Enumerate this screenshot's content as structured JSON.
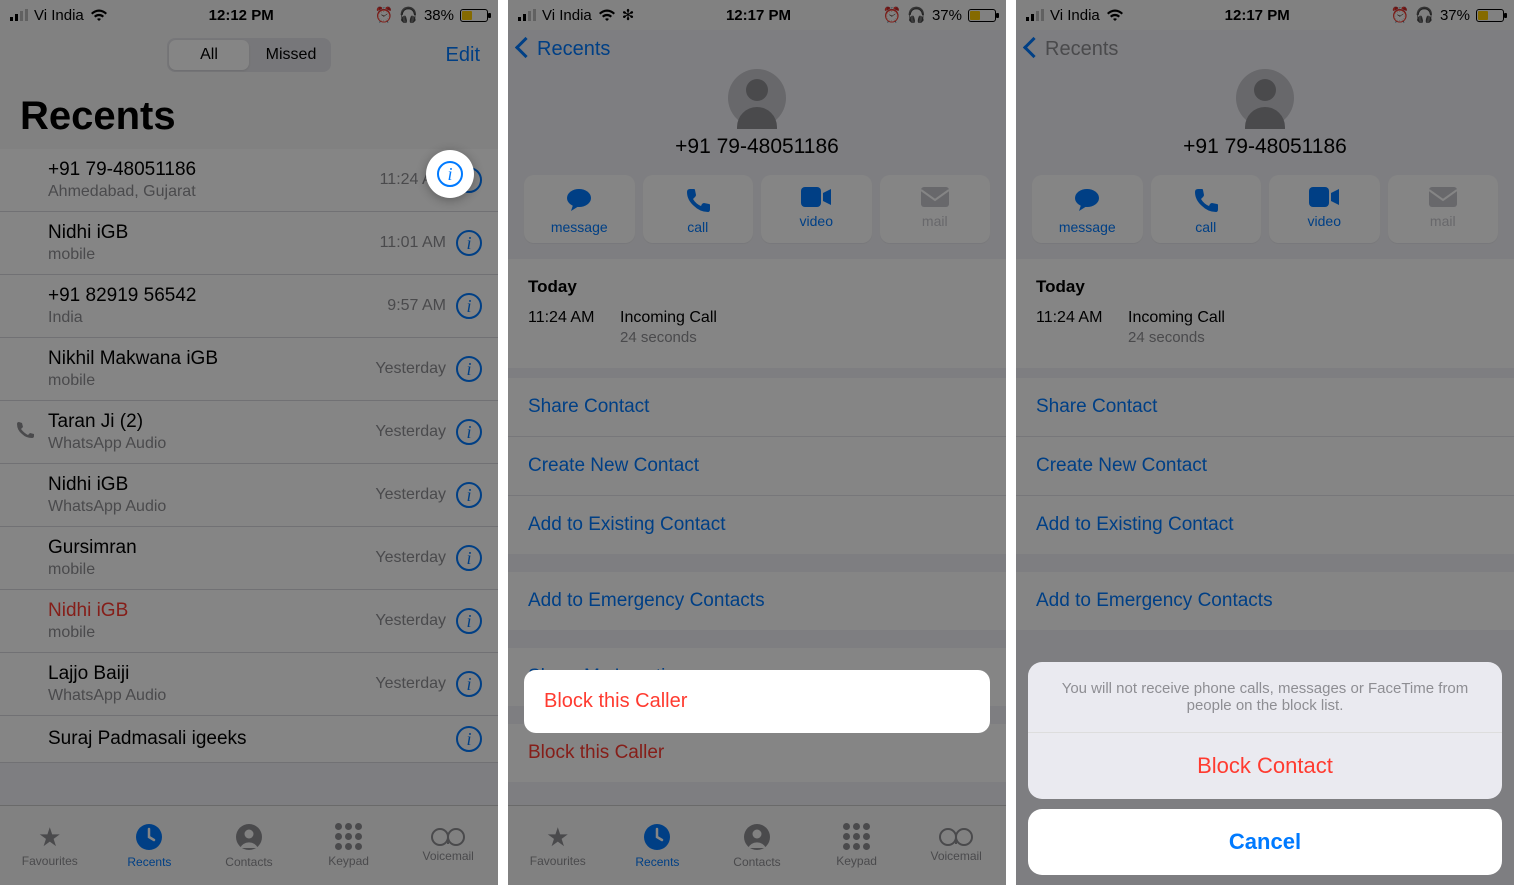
{
  "screens": {
    "s1": {
      "status": {
        "carrier": "Vi India",
        "time": "12:12 PM",
        "battery": "38%"
      },
      "nav": {
        "seg_all": "All",
        "seg_missed": "Missed",
        "edit": "Edit"
      },
      "title": "Recents",
      "calls": [
        {
          "name": "+91 79-48051186",
          "sub": "Ahmedabad, Gujarat",
          "time": "11:24 AM",
          "missed": false,
          "incoming": false,
          "highlight": true
        },
        {
          "name": "Nidhi iGB",
          "sub": "mobile",
          "time": "11:01 AM",
          "missed": false,
          "incoming": false
        },
        {
          "name": "+91 82919 56542",
          "sub": "India",
          "time": "9:57 AM",
          "missed": false,
          "incoming": false
        },
        {
          "name": "Nikhil Makwana iGB",
          "sub": "mobile",
          "time": "Yesterday",
          "missed": false,
          "incoming": false
        },
        {
          "name": "Taran Ji (2)",
          "sub": "WhatsApp Audio",
          "time": "Yesterday",
          "missed": false,
          "incoming": true
        },
        {
          "name": "Nidhi iGB",
          "sub": "WhatsApp Audio",
          "time": "Yesterday",
          "missed": false,
          "incoming": false
        },
        {
          "name": "Gursimran",
          "sub": "mobile",
          "time": "Yesterday",
          "missed": false,
          "incoming": false
        },
        {
          "name": "Nidhi iGB",
          "sub": "mobile",
          "time": "Yesterday",
          "missed": true,
          "incoming": false
        },
        {
          "name": "Lajjo Baiji",
          "sub": "WhatsApp Audio",
          "time": "Yesterday",
          "missed": false,
          "incoming": false
        },
        {
          "name": "Suraj Padmasali igeeks",
          "sub": "",
          "time": "",
          "missed": false,
          "incoming": false
        }
      ]
    },
    "s2": {
      "status": {
        "carrier": "Vi India",
        "time": "12:17 PM",
        "battery": "37%"
      },
      "back": "Recents",
      "number": "+91 79-48051186",
      "actions": {
        "message": "message",
        "call": "call",
        "video": "video",
        "mail": "mail"
      },
      "today": "Today",
      "log": {
        "time": "11:24 AM",
        "type": "Incoming Call",
        "duration": "24 seconds"
      },
      "rows": {
        "share_contact": "Share Contact",
        "create_new": "Create New Contact",
        "add_existing": "Add to Existing Contact",
        "emergency": "Add to Emergency Contacts",
        "share_loc": "Share My Location",
        "block": "Block this Caller"
      }
    },
    "s3": {
      "status": {
        "carrier": "Vi India",
        "time": "12:17 PM",
        "battery": "37%"
      },
      "back": "Recents",
      "number": "+91 79-48051186",
      "actions": {
        "message": "message",
        "call": "call",
        "video": "video",
        "mail": "mail"
      },
      "today": "Today",
      "log": {
        "time": "11:24 AM",
        "type": "Incoming Call",
        "duration": "24 seconds"
      },
      "rows": {
        "share_contact": "Share Contact",
        "create_new": "Create New Contact",
        "add_existing": "Add to Existing Contact",
        "emergency": "Add to Emergency Contacts"
      },
      "sheet": {
        "msg": "You will not receive phone calls, messages or FaceTime from people on the block list.",
        "block": "Block Contact",
        "cancel": "Cancel"
      }
    },
    "tabs": {
      "fav": "Favourites",
      "recents": "Recents",
      "contacts": "Contacts",
      "keypad": "Keypad",
      "voicemail": "Voicemail"
    }
  }
}
